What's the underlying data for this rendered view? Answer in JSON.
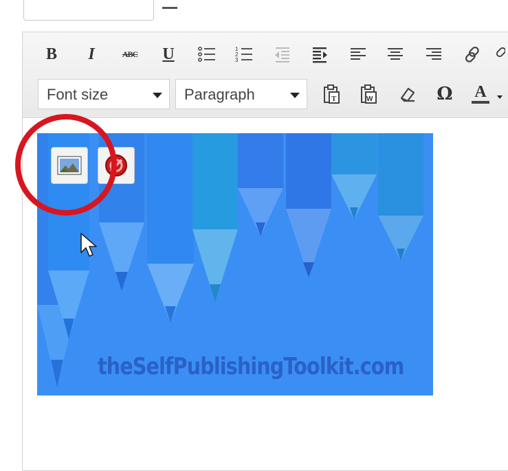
{
  "toolbar": {
    "row1": [
      {
        "name": "bold-button",
        "glyph": "B"
      },
      {
        "name": "italic-button",
        "glyph": "I"
      },
      {
        "name": "strikethrough-button",
        "glyph": "ABC"
      },
      {
        "name": "underline-button",
        "glyph": "U"
      },
      {
        "name": "bullet-list-button",
        "icon": "bullet-list-icon"
      },
      {
        "name": "numbered-list-button",
        "icon": "numbered-list-icon"
      },
      {
        "name": "outdent-button",
        "icon": "outdent-icon"
      },
      {
        "name": "indent-button",
        "icon": "indent-icon"
      },
      {
        "name": "align-left-button",
        "icon": "align-left-icon"
      },
      {
        "name": "align-center-button",
        "icon": "align-center-icon"
      },
      {
        "name": "align-right-button",
        "icon": "align-right-icon"
      },
      {
        "name": "link-button",
        "icon": "link-icon"
      }
    ],
    "font_size_label": "Font size",
    "paragraph_label": "Paragraph",
    "row2_icons": [
      "paste-text-icon",
      "paste-word-icon",
      "eraser-icon",
      "omega-icon",
      "text-color-icon"
    ],
    "text_color_glyph": "A",
    "omega_glyph": "Ω"
  },
  "image": {
    "watermark": "theSelfPublishingToolkit.com",
    "edit_button_icon": "edit-image-icon",
    "delete_button_icon": "delete-image-icon"
  },
  "colors": {
    "image_bg": "#3b8ff4",
    "highlight_circle": "#d81620",
    "watermark": "#2a61c7"
  }
}
